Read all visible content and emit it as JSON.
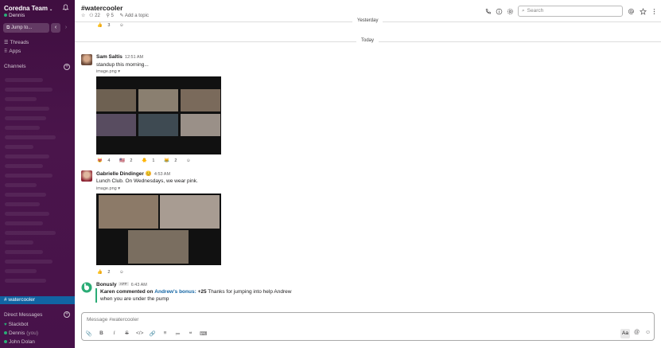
{
  "sidebar": {
    "team_name": "Coredna Team",
    "team_caret": "⌄",
    "user": "Dennis",
    "jump_to": "Jump to...",
    "back": "‹",
    "forward": "›",
    "links": [
      {
        "label": "Threads",
        "icon": "threads-icon"
      },
      {
        "label": "Apps",
        "icon": "apps-icon"
      }
    ],
    "channels_heading": "Channels",
    "active_channel": "# watercooler",
    "dm_heading": "Direct Messages",
    "dms": [
      {
        "name": "Slackbot",
        "suffix": ""
      },
      {
        "name": "Dennis",
        "suffix": "(you)"
      },
      {
        "name": "John Dolan",
        "suffix": ""
      }
    ]
  },
  "header": {
    "channel": "#watercooler",
    "members": "22",
    "pins": "5",
    "topic_link": "Add a topic",
    "search_placeholder": "Search"
  },
  "timeline": {
    "yesterday": "Yesterday",
    "today": "Today",
    "early_reactions": [
      {
        "emoji": "👍",
        "count": "3"
      }
    ],
    "messages": [
      {
        "author": "Sam Saltis",
        "time": "12:51 AM",
        "text": "standup this morning...",
        "attachment": "image.png",
        "reactions": [
          {
            "emoji": "😻",
            "count": "4"
          },
          {
            "emoji": "🇺🇸",
            "count": "2"
          },
          {
            "emoji": "🐥",
            "count": "1"
          },
          {
            "emoji": "😹",
            "count": "2"
          }
        ]
      },
      {
        "author": "Gabrielle Dindinger",
        "author_emoji": "😊",
        "time": "4:53 AM",
        "text": "Lunch Club. On Wednesdays, we wear pink.",
        "attachment": "image.png",
        "reactions": [
          {
            "emoji": "👍",
            "count": "2"
          }
        ]
      },
      {
        "author": "Bonusly",
        "badge": "APP",
        "time": "6:43 AM",
        "quote_who": "Karen commented on",
        "quote_link": "Andrew's bonus:",
        "quote_amount": "+25",
        "quote_text": "Thanks for jumping into help Andrew",
        "quote_line2": "when you are under the pump"
      }
    ]
  },
  "composer": {
    "placeholder": "Message #watercooler",
    "toolbar": [
      "📎",
      "B",
      "I",
      "S",
      "</>",
      "🔗",
      "≡",
      "≔",
      "❝",
      "⌨"
    ],
    "aa": "Aa",
    "at": "@",
    "emoji": "☺"
  },
  "colors": {
    "sidebar": "#4a154b",
    "active": "#1164a3",
    "presence": "#2bac76",
    "link": "#1264a3"
  }
}
